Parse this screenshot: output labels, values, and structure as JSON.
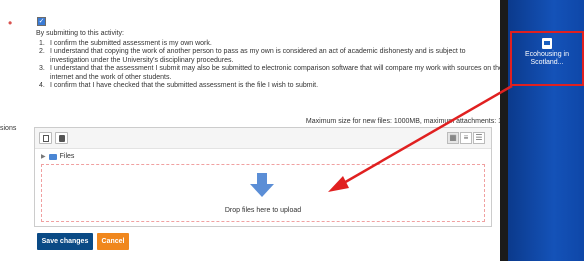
{
  "form": {
    "required_marker": "•",
    "checkbox_checked": true,
    "statement_intro": "By submitting to this activity:",
    "statements": [
      {
        "num": "1.",
        "text": "I confirm the submitted assessment is my own work."
      },
      {
        "num": "2.",
        "text": "I understand that copying the work of another person to pass as my own is considered an act of academic dishonesty and is subject to investigation under the University's disciplinary procedures."
      },
      {
        "num": "3.",
        "text": "I understand that the assessment I submit may also be submitted to electronic comparison software that will compare my work with sources on the internet and the work of other students."
      },
      {
        "num": "4.",
        "text": "I confirm that I have checked that the submitted assessment is the file I wish to submit."
      }
    ],
    "side_label": "sions",
    "max_size_text": "Maximum size for new files: 1000MB, maximum attachments: 1"
  },
  "filepicker": {
    "crumb_label": "Files",
    "drop_text": "Drop files here to upload"
  },
  "buttons": {
    "save_label": "Save changes",
    "cancel_label": "Cancel"
  },
  "desktop": {
    "icon_label": "Ecohousing in Scotland..."
  },
  "colors": {
    "save_button": "#0a4a85",
    "cancel_button": "#f0871d",
    "annotation_red": "#e02020",
    "desktop_blue": "#1452b8"
  }
}
